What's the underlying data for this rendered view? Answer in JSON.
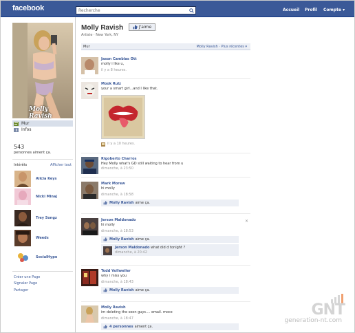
{
  "topbar": {
    "logo": "facebook",
    "search_placeholder": "Recherche",
    "nav": [
      "Accueil",
      "Profil",
      "Compte ▾"
    ]
  },
  "profile": {
    "name": "Molly Ravish",
    "like_label": "J'aime",
    "subtitle": "Artiste · New York, NY",
    "signature": "Molly Ravish"
  },
  "left_nav": [
    "Mur",
    "Infos"
  ],
  "friends": {
    "count": "543",
    "label": "personnes aiment ça."
  },
  "interests": {
    "title": "Intérêts",
    "see_all": "Afficher tout",
    "items": [
      "Alicia Keys",
      "Nicki Minaj",
      "Trey Songz",
      "Weeds",
      "SocialHype"
    ]
  },
  "footer_links": [
    "Créer une Page",
    "Signaler Page",
    "Partager"
  ],
  "tabs": {
    "wall": "Mur",
    "filter": "Molly Ravish · Plus récentes ▾"
  },
  "posts": [
    {
      "author": "Jason Cambias Ott",
      "message": "molly i like u,",
      "time": "il y a 8 heures."
    },
    {
      "author": "Mook Rulz",
      "message": "your a smart girl...and I like that.",
      "time": "il y a 10 heures."
    },
    {
      "author": "Rigoberto Charros",
      "message": "Hey Molly what's GD still waiting to hear from u",
      "time": "dimanche, à 23:50"
    },
    {
      "author": "Mark Morew",
      "message": "hi molly",
      "time": "dimanche, à 18:58",
      "like_who": "Molly Ravish",
      "like_rest": "aime ça."
    },
    {
      "author": "Jerson Maldonado",
      "message": "hi molly",
      "time": "dimanche, à 18:53",
      "like_who": "Molly Ravish",
      "like_rest": "aime ça.",
      "comment_author": "Jerson Maldonado",
      "comment_text": "what did d tonight ?",
      "comment_time": "dimanche, à 20:42"
    },
    {
      "author": "Todd Vollweiler",
      "message": "why i miss you",
      "time": "dimanche, à 18:43",
      "like_who": "Molly Ravish",
      "like_rest": "aime ça."
    },
    {
      "author": "Molly Ravish",
      "message": "im deleting the soon guys.... email. moce",
      "time": "dimanche, à 18:47",
      "like_who": "4 personnes",
      "like_rest": "aiment ça."
    }
  ],
  "watermark": {
    "main": "GNT",
    "sub": "generation-nt.com"
  },
  "colors": {
    "brand": "#3b5998",
    "link": "#3b5998",
    "panel": "#eceff5"
  }
}
